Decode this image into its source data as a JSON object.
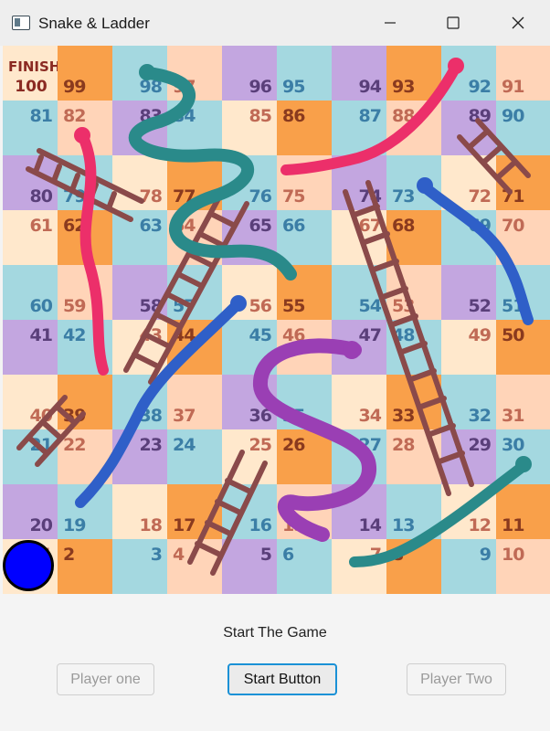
{
  "window": {
    "title": "Snake & Ladder",
    "controls": [
      "minimize",
      "maximize",
      "close"
    ]
  },
  "board": {
    "finish_label": "FINISH",
    "finish_number": "100",
    "cells": [
      {
        "n": "99",
        "bg": "#f9a04a",
        "fg": "#8a3a1e"
      },
      {
        "n": "98",
        "bg": "#a4d8e0",
        "fg": "#3b7ea6"
      },
      {
        "n": "97",
        "bg": "#ffd4b8",
        "fg": "#c06a55"
      },
      {
        "n": "96",
        "bg": "#c3a6e0",
        "fg": "#5a3f7a"
      },
      {
        "n": "95",
        "bg": "#a4d8e0",
        "fg": "#3b7ea6"
      },
      {
        "n": "94",
        "bg": "#c3a6e0",
        "fg": "#5a3f7a"
      },
      {
        "n": "93",
        "bg": "#f9a04a",
        "fg": "#8a3a1e"
      },
      {
        "n": "92",
        "bg": "#a4d8e0",
        "fg": "#3b7ea6"
      },
      {
        "n": "91",
        "bg": "#ffd4b8",
        "fg": "#c06a55"
      },
      {
        "n": "81",
        "bg": "#a4d8e0",
        "fg": "#3b7ea6"
      },
      {
        "n": "82",
        "bg": "#ffd4b8",
        "fg": "#c06a55"
      },
      {
        "n": "83",
        "bg": "#c3a6e0",
        "fg": "#5a3f7a"
      },
      {
        "n": "84",
        "bg": "#a4d8e0",
        "fg": "#3b7ea6"
      },
      {
        "n": "85",
        "bg": "#ffe8cc",
        "fg": "#c06a55"
      },
      {
        "n": "86",
        "bg": "#f9a04a",
        "fg": "#8a3a1e"
      },
      {
        "n": "87",
        "bg": "#a4d8e0",
        "fg": "#3b7ea6"
      },
      {
        "n": "88",
        "bg": "#ffd4b8",
        "fg": "#c06a55"
      },
      {
        "n": "89",
        "bg": "#c3a6e0",
        "fg": "#5a3f7a"
      },
      {
        "n": "90",
        "bg": "#a4d8e0",
        "fg": "#3b7ea6"
      },
      {
        "n": "80",
        "bg": "#c3a6e0",
        "fg": "#5a3f7a"
      },
      {
        "n": "79",
        "bg": "#a4d8e0",
        "fg": "#3b7ea6"
      },
      {
        "n": "78",
        "bg": "#ffe8cc",
        "fg": "#c06a55"
      },
      {
        "n": "77",
        "bg": "#f9a04a",
        "fg": "#8a3a1e"
      },
      {
        "n": "76",
        "bg": "#a4d8e0",
        "fg": "#3b7ea6"
      },
      {
        "n": "75",
        "bg": "#ffd4b8",
        "fg": "#c06a55"
      },
      {
        "n": "74",
        "bg": "#c3a6e0",
        "fg": "#5a3f7a"
      },
      {
        "n": "73",
        "bg": "#a4d8e0",
        "fg": "#3b7ea6"
      },
      {
        "n": "72",
        "bg": "#ffe8cc",
        "fg": "#c06a55"
      },
      {
        "n": "71",
        "bg": "#f9a04a",
        "fg": "#8a3a1e"
      },
      {
        "n": "61",
        "bg": "#ffe8cc",
        "fg": "#c06a55"
      },
      {
        "n": "62",
        "bg": "#f9a04a",
        "fg": "#8a3a1e"
      },
      {
        "n": "63",
        "bg": "#a4d8e0",
        "fg": "#3b7ea6"
      },
      {
        "n": "64",
        "bg": "#ffd4b8",
        "fg": "#c06a55"
      },
      {
        "n": "65",
        "bg": "#c3a6e0",
        "fg": "#5a3f7a"
      },
      {
        "n": "66",
        "bg": "#a4d8e0",
        "fg": "#3b7ea6"
      },
      {
        "n": "67",
        "bg": "#ffe8cc",
        "fg": "#c06a55"
      },
      {
        "n": "68",
        "bg": "#f9a04a",
        "fg": "#8a3a1e"
      },
      {
        "n": "69",
        "bg": "#a4d8e0",
        "fg": "#3b7ea6"
      },
      {
        "n": "70",
        "bg": "#ffd4b8",
        "fg": "#c06a55"
      },
      {
        "n": "60",
        "bg": "#a4d8e0",
        "fg": "#3b7ea6"
      },
      {
        "n": "59",
        "bg": "#ffd4b8",
        "fg": "#c06a55"
      },
      {
        "n": "58",
        "bg": "#c3a6e0",
        "fg": "#5a3f7a"
      },
      {
        "n": "57",
        "bg": "#a4d8e0",
        "fg": "#3b7ea6"
      },
      {
        "n": "56",
        "bg": "#ffe8cc",
        "fg": "#c06a55"
      },
      {
        "n": "55",
        "bg": "#f9a04a",
        "fg": "#8a3a1e"
      },
      {
        "n": "54",
        "bg": "#a4d8e0",
        "fg": "#3b7ea6"
      },
      {
        "n": "53",
        "bg": "#ffd4b8",
        "fg": "#c06a55"
      },
      {
        "n": "52",
        "bg": "#c3a6e0",
        "fg": "#5a3f7a"
      },
      {
        "n": "51",
        "bg": "#a4d8e0",
        "fg": "#3b7ea6"
      },
      {
        "n": "41",
        "bg": "#c3a6e0",
        "fg": "#5a3f7a"
      },
      {
        "n": "42",
        "bg": "#a4d8e0",
        "fg": "#3b7ea6"
      },
      {
        "n": "43",
        "bg": "#ffe8cc",
        "fg": "#c06a55"
      },
      {
        "n": "44",
        "bg": "#f9a04a",
        "fg": "#8a3a1e"
      },
      {
        "n": "45",
        "bg": "#a4d8e0",
        "fg": "#3b7ea6"
      },
      {
        "n": "46",
        "bg": "#ffd4b8",
        "fg": "#c06a55"
      },
      {
        "n": "47",
        "bg": "#c3a6e0",
        "fg": "#5a3f7a"
      },
      {
        "n": "48",
        "bg": "#a4d8e0",
        "fg": "#3b7ea6"
      },
      {
        "n": "49",
        "bg": "#ffe8cc",
        "fg": "#c06a55"
      },
      {
        "n": "50",
        "bg": "#f9a04a",
        "fg": "#8a3a1e"
      },
      {
        "n": "40",
        "bg": "#ffe8cc",
        "fg": "#c06a55"
      },
      {
        "n": "39",
        "bg": "#f9a04a",
        "fg": "#8a3a1e"
      },
      {
        "n": "38",
        "bg": "#a4d8e0",
        "fg": "#3b7ea6"
      },
      {
        "n": "37",
        "bg": "#ffd4b8",
        "fg": "#c06a55"
      },
      {
        "n": "36",
        "bg": "#c3a6e0",
        "fg": "#5a3f7a"
      },
      {
        "n": "35",
        "bg": "#a4d8e0",
        "fg": "#3b7ea6"
      },
      {
        "n": "34",
        "bg": "#ffe8cc",
        "fg": "#c06a55"
      },
      {
        "n": "33",
        "bg": "#f9a04a",
        "fg": "#8a3a1e"
      },
      {
        "n": "32",
        "bg": "#a4d8e0",
        "fg": "#3b7ea6"
      },
      {
        "n": "31",
        "bg": "#ffd4b8",
        "fg": "#c06a55"
      },
      {
        "n": "21",
        "bg": "#a4d8e0",
        "fg": "#3b7ea6"
      },
      {
        "n": "22",
        "bg": "#ffd4b8",
        "fg": "#c06a55"
      },
      {
        "n": "23",
        "bg": "#c3a6e0",
        "fg": "#5a3f7a"
      },
      {
        "n": "24",
        "bg": "#a4d8e0",
        "fg": "#3b7ea6"
      },
      {
        "n": "25",
        "bg": "#ffe8cc",
        "fg": "#c06a55"
      },
      {
        "n": "26",
        "bg": "#f9a04a",
        "fg": "#8a3a1e"
      },
      {
        "n": "27",
        "bg": "#a4d8e0",
        "fg": "#3b7ea6"
      },
      {
        "n": "28",
        "bg": "#ffd4b8",
        "fg": "#c06a55"
      },
      {
        "n": "29",
        "bg": "#c3a6e0",
        "fg": "#5a3f7a"
      },
      {
        "n": "30",
        "bg": "#a4d8e0",
        "fg": "#3b7ea6"
      },
      {
        "n": "20",
        "bg": "#c3a6e0",
        "fg": "#5a3f7a"
      },
      {
        "n": "19",
        "bg": "#a4d8e0",
        "fg": "#3b7ea6"
      },
      {
        "n": "18",
        "bg": "#ffe8cc",
        "fg": "#c06a55"
      },
      {
        "n": "17",
        "bg": "#f9a04a",
        "fg": "#8a3a1e"
      },
      {
        "n": "16",
        "bg": "#a4d8e0",
        "fg": "#3b7ea6"
      },
      {
        "n": "15",
        "bg": "#ffd4b8",
        "fg": "#c06a55"
      },
      {
        "n": "14",
        "bg": "#c3a6e0",
        "fg": "#5a3f7a"
      },
      {
        "n": "13",
        "bg": "#a4d8e0",
        "fg": "#3b7ea6"
      },
      {
        "n": "12",
        "bg": "#ffe8cc",
        "fg": "#c06a55"
      },
      {
        "n": "11",
        "bg": "#f9a04a",
        "fg": "#8a3a1e"
      },
      {
        "n": "1",
        "bg": "#ffe8cc",
        "fg": "#c06a55"
      },
      {
        "n": "2",
        "bg": "#f9a04a",
        "fg": "#8a3a1e"
      },
      {
        "n": "3",
        "bg": "#a4d8e0",
        "fg": "#3b7ea6"
      },
      {
        "n": "4",
        "bg": "#ffd4b8",
        "fg": "#c06a55"
      },
      {
        "n": "5",
        "bg": "#c3a6e0",
        "fg": "#5a3f7a"
      },
      {
        "n": "6",
        "bg": "#a4d8e0",
        "fg": "#3b7ea6"
      },
      {
        "n": "7",
        "bg": "#ffe8cc",
        "fg": "#c06a55"
      },
      {
        "n": "8",
        "bg": "#f9a04a",
        "fg": "#8a3a1e"
      },
      {
        "n": "9",
        "bg": "#a4d8e0",
        "fg": "#3b7ea6"
      },
      {
        "n": "10",
        "bg": "#ffd4b8",
        "fg": "#c06a55"
      }
    ],
    "token": {
      "player": "one",
      "cell": "1",
      "color": "#0000ff"
    }
  },
  "controls": {
    "status": "Start The Game",
    "player_one": "Player one",
    "start": "Start Button",
    "player_two": "Player Two"
  }
}
